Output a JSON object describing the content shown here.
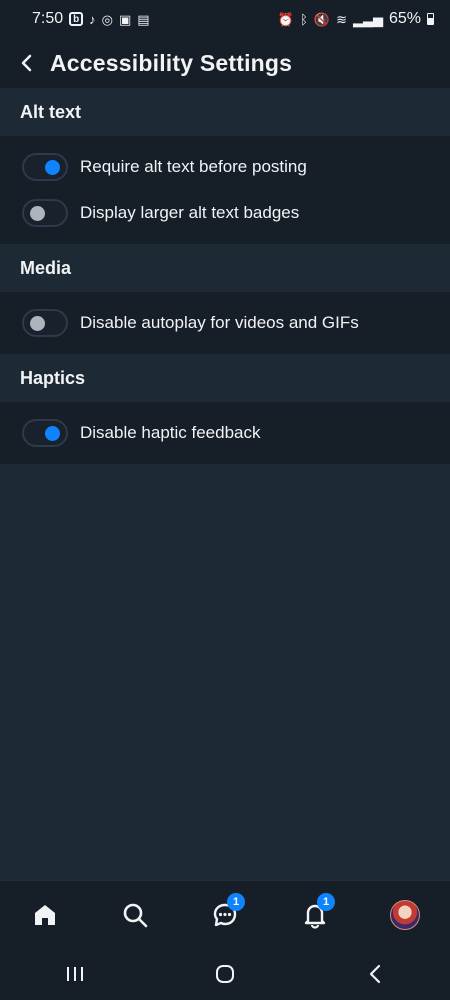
{
  "status_bar": {
    "time": "7:50",
    "left_icons": [
      "b-icon",
      "tiktok-icon",
      "instagram-icon",
      "gallery-icon",
      "notification-icon"
    ],
    "right_icons": [
      "alarm-icon",
      "bluetooth-icon",
      "mute-icon",
      "wifi-icon",
      "signal-icon"
    ],
    "battery": "65%"
  },
  "header": {
    "title": "Accessibility Settings"
  },
  "sections": [
    {
      "title": "Alt text",
      "items": [
        {
          "label": "Require alt text before posting",
          "on": true
        },
        {
          "label": "Display larger alt text badges",
          "on": false
        }
      ]
    },
    {
      "title": "Media",
      "items": [
        {
          "label": "Disable autoplay for videos and GIFs",
          "on": false
        }
      ]
    },
    {
      "title": "Haptics",
      "items": [
        {
          "label": "Disable haptic feedback",
          "on": true
        }
      ]
    }
  ],
  "bottom_nav": {
    "items": [
      "home-icon",
      "search-icon",
      "chat-icon",
      "bell-icon",
      "avatar"
    ],
    "chat_badge": "1",
    "notifications_badge": "1"
  },
  "colors": {
    "accent": "#1083fe",
    "background": "#1e2936",
    "surface": "#161e27"
  }
}
